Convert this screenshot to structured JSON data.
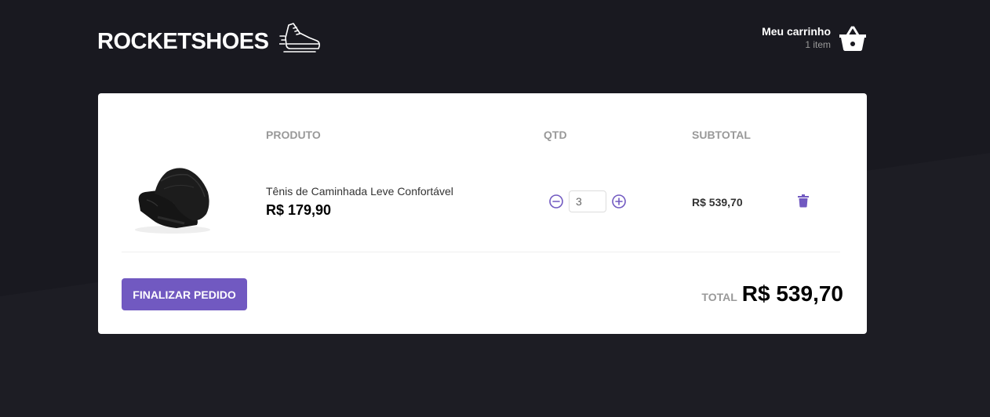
{
  "brand": {
    "name": "ROCKETSHOES",
    "icon": "running-shoe-icon"
  },
  "cart": {
    "title": "Meu carrinho",
    "count": "1 item",
    "icon": "basket-icon"
  },
  "table": {
    "headers": {
      "product": "PRODUTO",
      "qty": "QTD",
      "subtotal": "SUBTOTAL"
    },
    "items": [
      {
        "name": "Tênis de Caminhada Leve Confortável",
        "price": "R$ 179,90",
        "quantity": "3",
        "subtotal": "R$ 539,70"
      }
    ]
  },
  "footer": {
    "checkout_label": "FINALIZAR PEDIDO",
    "total_label": "TOTAL",
    "total_value": "R$ 539,70"
  },
  "colors": {
    "background": "#191920",
    "accent": "#7159c1",
    "panel": "#ffffff"
  }
}
